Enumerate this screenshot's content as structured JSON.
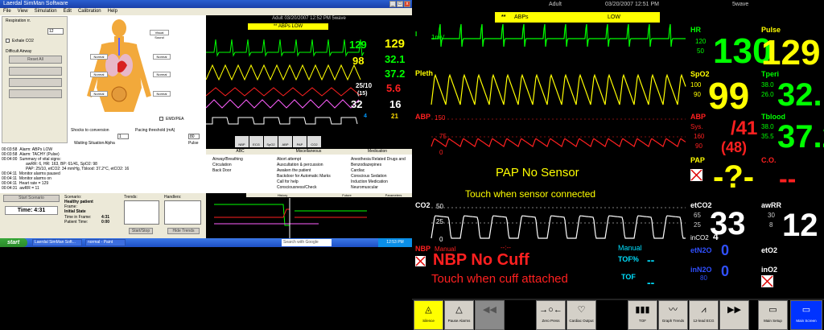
{
  "left": {
    "window_title": "Laerdal SimMan Software",
    "menu": [
      "File",
      "View",
      "Simulation",
      "Edit",
      "Calibration",
      "Help"
    ],
    "respiration": {
      "label": "Respiration\nrr.",
      "value": "12"
    },
    "exhale_co2": "Exhale CO2",
    "difficult_airway": "Difficult Airway",
    "reset_all": "Reset All",
    "body_labels": [
      "Normal",
      "Normal",
      "Normal",
      "Normal",
      "Normal",
      "Normal"
    ],
    "visual_sound": "Visual Sound",
    "emd_pea": "EMD/PEA",
    "shocks_label": "Shocks to conversion",
    "shocks_value": "1",
    "pacing_label": "Pacing threshold (mA)",
    "pacing_value": "80",
    "waiting": "Waiting Situation",
    "alpha": "Alpha",
    "pulse": "Pulse",
    "log": [
      [
        "00:03:58",
        "Alarm: ABPs LOW"
      ],
      [
        "00:03:58",
        "Alarm: TACHY (Pulse)"
      ],
      [
        "00:04:00",
        "Summary of vital signs:"
      ],
      [
        "",
        "awRR: 6, HR: 163, BP: 61/41, SpO2: 98"
      ],
      [
        "",
        "PAP: 25/10, etCO2: 34 mmHg, Tblood: 37.2°C, etCO2: 16"
      ],
      [
        "00:04:11",
        "Monitor alarms paused"
      ],
      [
        "00:04:11",
        "Monitor alarms on"
      ],
      [
        "00:04:11",
        "Heart rate = 129"
      ],
      [
        "00:04:31",
        "awRR = 11"
      ]
    ],
    "tabs": [
      "ABC",
      "Miscellaneous",
      "Medication"
    ],
    "abc_items": [
      "Airway/Breathing",
      "Circulation",
      "Back Door"
    ],
    "misc_items": [
      "Abort attempt",
      "Auscultation & percussion",
      "Awaken the patient",
      "Backdoor for Automatic Marks",
      "Call for help",
      "Consciousness/Check"
    ],
    "med_items": [
      "Anesthesia Related Drugs and",
      "Benzodiazepines",
      "Cardiac",
      "Conscious Sedation",
      "Induction Medication",
      "Neuromuscular"
    ],
    "start_scenario": "Start Scenario",
    "time": "Time: 4:31",
    "scenario": {
      "label": "Scenario:",
      "name": "Healthy patient",
      "frame_label": "Frame:",
      "frame": "Initial State",
      "time_in_frame_label": "Time in Frame:",
      "time_in_frame": "4:31",
      "patient_time_label": "Patient Time:",
      "patient_time": "0:00"
    },
    "trends": "Trends:",
    "handlers": "Handlers:",
    "start_stop": "Start/Stop",
    "hide_trends": "Hide Trends",
    "history": "History",
    "future": "Future",
    "parameters": "Parameters",
    "taskbar": {
      "start": "start",
      "tasks": [
        "Laerdal SimMan Soft...",
        "normal - Paint"
      ],
      "search": "Search with Google",
      "clock": "12:53 PM"
    },
    "mini": {
      "header": "Adult    03/20/2007 12:52 PM    5wave",
      "alarm": "** ABPs    LOW",
      "hr": "129",
      "pulse": "129",
      "spo2": "98",
      "tperi": "32.1",
      "tblood": "37.2",
      "pap": "25/10",
      "pap_mean": "(15)",
      "abp_val": "5.6",
      "etco2": "32",
      "awrr": "16",
      "tof": "4",
      "etco2_b": "21",
      "buttons": [
        "NBP",
        "ECG",
        "SpO2",
        "ABP",
        "PAP",
        "CO2"
      ]
    }
  },
  "monitor": {
    "header": {
      "mode": "Adult",
      "datetime": "03/20/2007 12:51 PM",
      "layout": "5wave"
    },
    "alarm": {
      "stars": "**",
      "label": "ABPs",
      "level": "LOW"
    },
    "ecg_label": "I",
    "ecg_scale": "1mV",
    "pleth_label": "Pleth",
    "abp_label": "ABP",
    "abp_scale_hi": "150",
    "abp_scale_mid": "75",
    "abp_scale_lo": "0",
    "pap_message": "PAP No Sensor",
    "pap_sub": "Touch when sensor connected",
    "co2_label": "CO2",
    "co2_hi": "50",
    "co2_mid": "25",
    "co2_lo": "0",
    "nbp_label": "NBP",
    "nbp_manual": "Manual",
    "nbp_dash": "--:--",
    "nbp_message": "NBP No Cuff",
    "nbp_sub": "Touch when cuff attached",
    "tof_manual": "Manual",
    "tof_pct_label": "TOF%",
    "tof_pct": "--",
    "tof_label": "TOF",
    "tof_val": "--",
    "hr": {
      "label": "HR",
      "value": "130",
      "hi": "120",
      "lo": "50"
    },
    "pulse": {
      "label": "Pulse",
      "value": "129"
    },
    "spo2": {
      "label": "SpO2",
      "value": "99",
      "hi": "100",
      "lo": "90"
    },
    "tperi": {
      "label": "Tperi",
      "value": "32.1",
      "hi": "38.0",
      "lo": "26.0"
    },
    "abp": {
      "label": "ABP",
      "sys_label": "Sys.",
      "value": "/41",
      "mean": "(48)",
      "hi": "160",
      "lo": "90"
    },
    "tblood": {
      "label": "Tblood",
      "value": "37.2",
      "hi": "38.0",
      "lo": "35.5"
    },
    "pap": {
      "label": "PAP",
      "value": "-?-"
    },
    "co": {
      "label": "C.O.",
      "value": "--"
    },
    "etco2": {
      "label": "etCO2",
      "value": "33",
      "hi": "65",
      "lo": "25"
    },
    "awrr": {
      "label": "awRR",
      "value": "12",
      "hi": "30",
      "lo": "8"
    },
    "inco2": {
      "label": "inCO2",
      "value": "4"
    },
    "etn2o": {
      "label": "etN2O",
      "value": "0"
    },
    "inn2o": {
      "label": "inN2O",
      "value": "0",
      "sub": "80"
    },
    "eto2": {
      "label": "etO2"
    },
    "ino2": {
      "label": "inO2"
    },
    "toolbar": [
      "Silence",
      "Pause Alarms",
      "",
      "Zero Press",
      "Cardiac Output",
      "",
      "TOF",
      "Graph Trends",
      "12-lead ECG",
      "",
      "Main Setup",
      "Main Screen"
    ]
  },
  "colors": {
    "green": "#00ff00",
    "yellow": "#ffff00",
    "red": "#ff2020",
    "cyan": "#00e0ff",
    "blue": "#3050ff",
    "white": "#ffffff"
  }
}
